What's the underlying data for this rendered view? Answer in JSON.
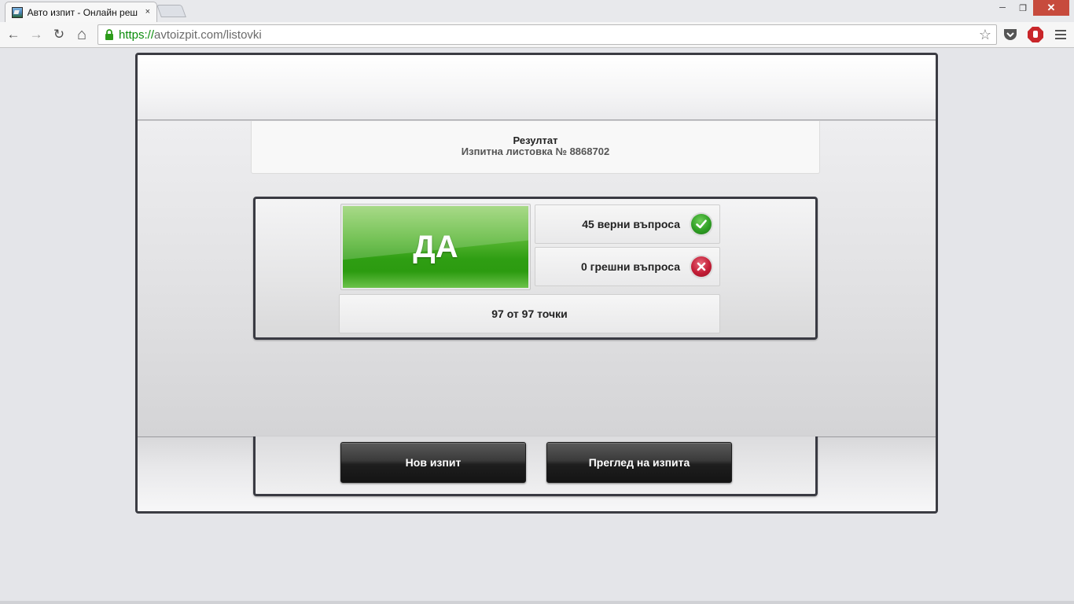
{
  "browser": {
    "tab_title": "Авто изпит - Онлайн реш",
    "tab_close": "×",
    "url_scheme": "https://",
    "url_rest": "avtoizpit.com/listovki",
    "window_controls": {
      "minimize": "─",
      "restore": "❐",
      "close": "✕"
    },
    "nav": {
      "back": "←",
      "forward": "→",
      "reload": "↻",
      "home": "⌂"
    },
    "star": "☆"
  },
  "result": {
    "title": "Резултат",
    "subtitle": "Изпитна листовка № 8868702",
    "verdict": "ДА",
    "correct_label": "45 верни въпроса",
    "wrong_label": "0 грешни въпроса",
    "points_label": "97 от 97 точки"
  },
  "actions": {
    "new_exam": "Нов изпит",
    "review_exam": "Преглед на изпита"
  },
  "colors": {
    "verdict_green": "#2f9e13",
    "ok_icon": "#2f9e24",
    "error_icon": "#c31d36",
    "button_dark": "#1e1e1e"
  }
}
